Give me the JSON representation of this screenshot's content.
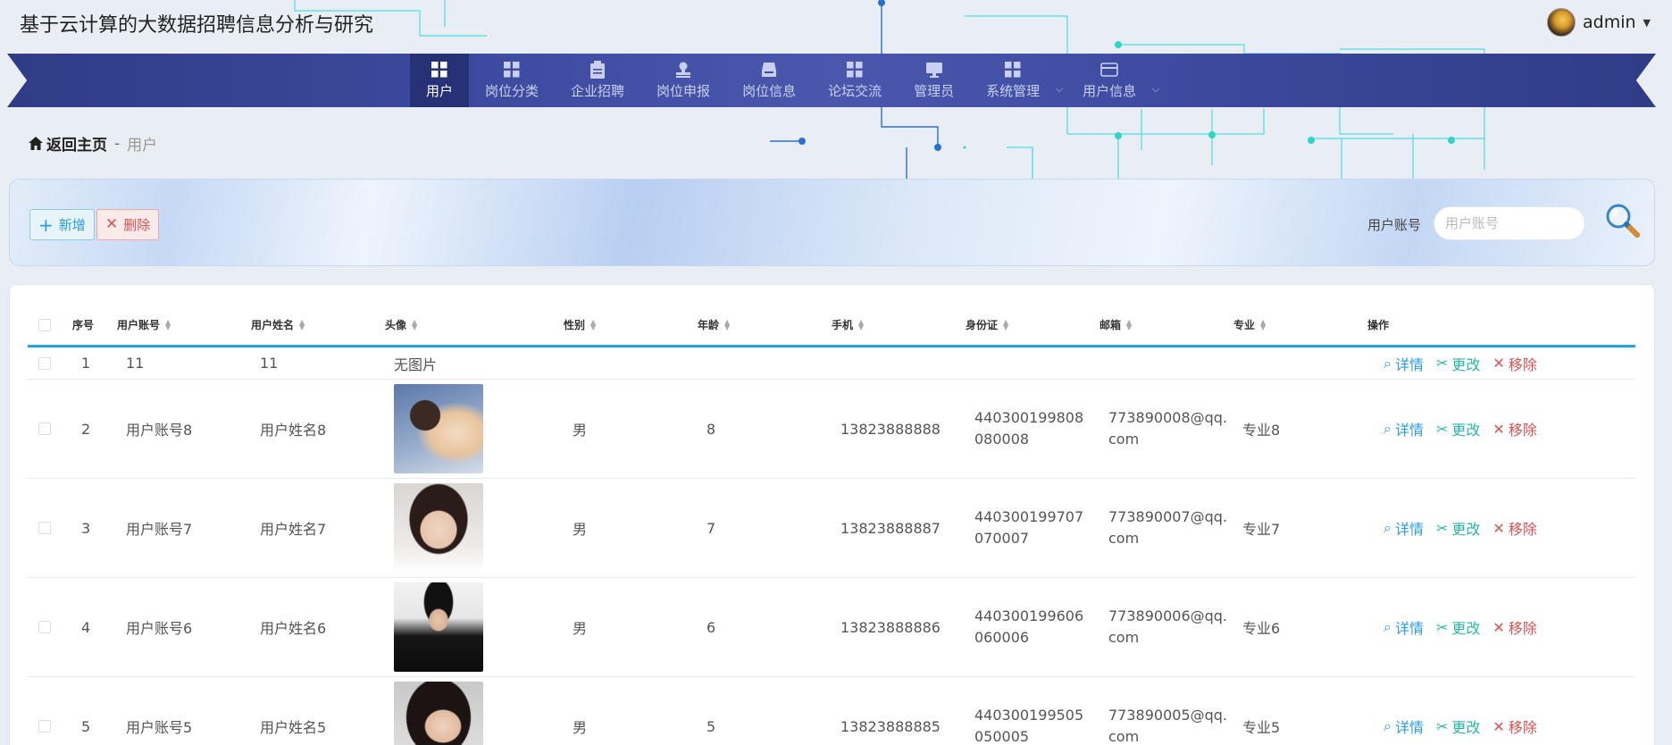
{
  "app": {
    "title": "基于云计算的大数据招聘信息分析与研究"
  },
  "user": {
    "name": "admin"
  },
  "nav": {
    "items": [
      {
        "label": "用户",
        "icon": "grid-icon",
        "active": true
      },
      {
        "label": "岗位分类",
        "icon": "grid-icon"
      },
      {
        "label": "企业招聘",
        "icon": "clipboard-icon"
      },
      {
        "label": "岗位申报",
        "icon": "stamp-icon"
      },
      {
        "label": "岗位信息",
        "icon": "inbox-icon"
      },
      {
        "label": "论坛交流",
        "icon": "grid-icon"
      },
      {
        "label": "管理员",
        "icon": "monitor-icon"
      },
      {
        "label": "系统管理",
        "icon": "grid-icon",
        "dropdown": true
      },
      {
        "label": "用户信息",
        "icon": "card-icon",
        "dropdown": true
      }
    ]
  },
  "breadcrumb": {
    "home": "返回主页",
    "separator": "-",
    "current": "用户"
  },
  "toolbar": {
    "add_label": "新增",
    "delete_label": "删除"
  },
  "search": {
    "label": "用户账号",
    "placeholder": "用户账号",
    "value": ""
  },
  "table": {
    "columns": [
      "序号",
      "用户账号",
      "用户姓名",
      "头像",
      "性别",
      "年龄",
      "手机",
      "身份证",
      "邮箱",
      "专业",
      "操作"
    ],
    "no_image_text": "无图片",
    "actions": {
      "detail": "详情",
      "edit": "更改",
      "remove": "移除"
    },
    "rows": [
      {
        "index": "1",
        "account": "11",
        "name": "11",
        "avatar": "无图片",
        "gender": "",
        "age": "",
        "phone": "",
        "id_card": "",
        "email": "",
        "major": ""
      },
      {
        "index": "2",
        "account": "用户账号8",
        "name": "用户姓名8",
        "avatar": "photo",
        "gender": "男",
        "age": "8",
        "phone": "13823888888",
        "id_card": "440300199808080008",
        "email": "773890008@qq.com",
        "major": "专业8"
      },
      {
        "index": "3",
        "account": "用户账号7",
        "name": "用户姓名7",
        "avatar": "photo",
        "gender": "男",
        "age": "7",
        "phone": "13823888887",
        "id_card": "440300199707070007",
        "email": "773890007@qq.com",
        "major": "专业7"
      },
      {
        "index": "4",
        "account": "用户账号6",
        "name": "用户姓名6",
        "avatar": "photo",
        "gender": "男",
        "age": "6",
        "phone": "13823888886",
        "id_card": "440300199606060006",
        "email": "773890006@qq.com",
        "major": "专业6"
      },
      {
        "index": "5",
        "account": "用户账号5",
        "name": "用户姓名5",
        "avatar": "photo",
        "gender": "男",
        "age": "5",
        "phone": "13823888885",
        "id_card": "440300199505050005",
        "email": "773890005@qq.com",
        "major": "专业5"
      }
    ]
  },
  "colors": {
    "nav_bg": "#3d4ba0",
    "nav_active": "#263275",
    "accent": "#1ea7de",
    "danger": "#e05252",
    "edit": "#2bb5a9"
  }
}
